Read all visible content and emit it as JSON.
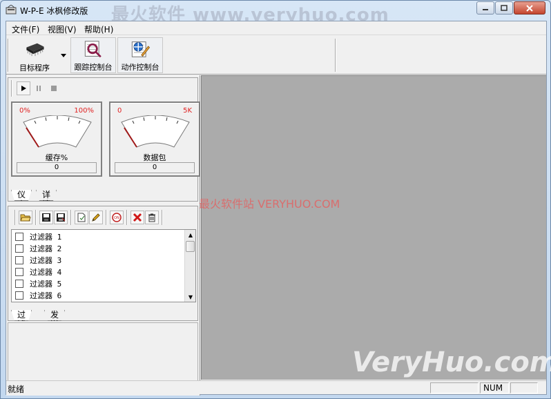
{
  "window": {
    "title": "W-P-E 冰枫修改版",
    "title_watermark": "最火软件 www.veryhuo.com"
  },
  "menu": [
    {
      "label": "文件(F)"
    },
    {
      "label": "视图(V)"
    },
    {
      "label": "帮助(H)"
    }
  ],
  "toolbar": {
    "target_label": "目标程序",
    "trace_label": "跟踪控制台",
    "action_label": "动作控制台"
  },
  "monitor": {
    "buffer": {
      "min": "0%",
      "max": "100%",
      "label": "缓存%",
      "value": "0"
    },
    "packets": {
      "min": "0",
      "max": "5K",
      "label": "数据包",
      "value": "0"
    },
    "tabs": [
      "仪表",
      "详情"
    ]
  },
  "filters": {
    "items": [
      "过滤器 1",
      "过滤器 2",
      "过滤器 3",
      "过滤器 4",
      "过滤器 5",
      "过滤器 6"
    ],
    "tabs": [
      "过滤器",
      "发送"
    ]
  },
  "workspace": {
    "watermark_mid": "最火软件站 VERYHUO.COM",
    "watermark_bottom": "VeryHuo.com"
  },
  "status": {
    "text": "就绪",
    "num": "NUM"
  },
  "colors": {
    "gauge_tick": "#e02020",
    "workspace": "#ababab",
    "close_button": "#c4452f"
  }
}
